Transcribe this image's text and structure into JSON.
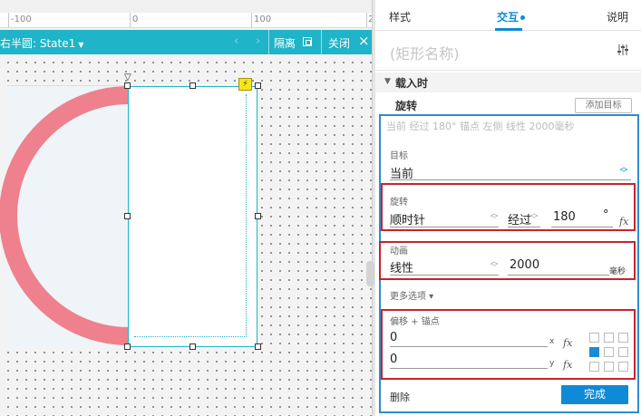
{
  "canvas": {
    "ruler": {
      "labels": [
        "-100",
        "0",
        "100",
        "2"
      ]
    },
    "state_bar": {
      "state_name": "右半圆: State1",
      "isolate_label": "隔离",
      "close_label": "关闭"
    },
    "colors": {
      "ring": "#ee818d",
      "state_bar": "#1fb4c7",
      "selection": "#1fb4c7"
    }
  },
  "panel": {
    "tabs": [
      {
        "label": "样式"
      },
      {
        "label": "交互"
      },
      {
        "label": "说明"
      }
    ],
    "shape_name_placeholder": "(矩形名称)",
    "event": {
      "title": "载入时"
    },
    "action": {
      "title": "旋转",
      "add_target_label": "添加目标",
      "summary": "当前 经过 180° 锚点 左侧 线性 2000毫秒",
      "target": {
        "label": "目标",
        "value": "当前"
      },
      "rotate": {
        "label": "旋转",
        "direction": "顺时针",
        "mode": "经过",
        "degrees": "180",
        "unit": "°",
        "fx": "fx"
      },
      "animate": {
        "label": "动画",
        "easing": "线性",
        "duration": "2000",
        "unit": "毫秒"
      },
      "more_options": "更多选项",
      "offset": {
        "label": "偏移 + 锚点",
        "x_value": "0",
        "x_axis": "x",
        "y_value": "0",
        "y_axis": "y",
        "fx": "fx",
        "anchor_selected": "left-center"
      },
      "delete_label": "删除",
      "done_label": "完成"
    },
    "colors": {
      "accent": "#0e8ad6",
      "highlight_box": "#c8232c",
      "action_box": "#2f8bd1"
    }
  }
}
